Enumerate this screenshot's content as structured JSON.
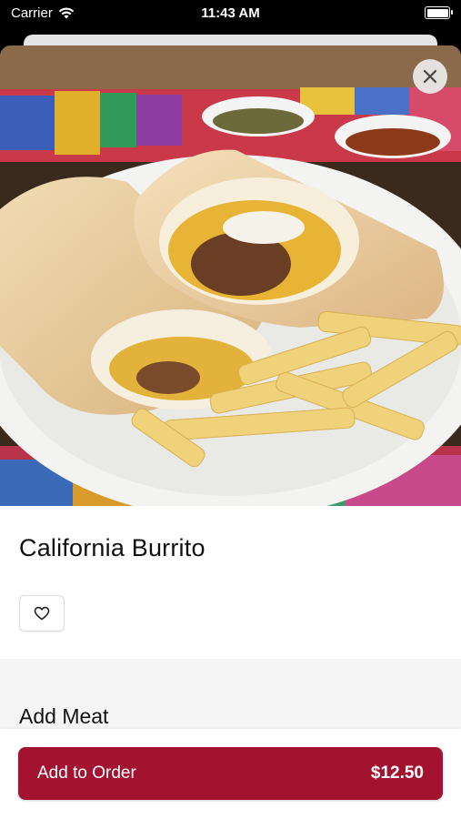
{
  "status_bar": {
    "carrier": "Carrier",
    "time": "11:43 AM",
    "battery_level": 1.0
  },
  "item": {
    "title": "California Burrito",
    "image_subject": "burrito-with-fries-photo"
  },
  "actions": {
    "close_icon": "close-icon",
    "favorite_icon": "heart-icon"
  },
  "options": {
    "section_title": "Add Meat"
  },
  "order": {
    "button_label": "Add to Order",
    "price": "$12.50"
  },
  "colors": {
    "accent": "#a3132f",
    "options_background": "#f5f5f5"
  }
}
